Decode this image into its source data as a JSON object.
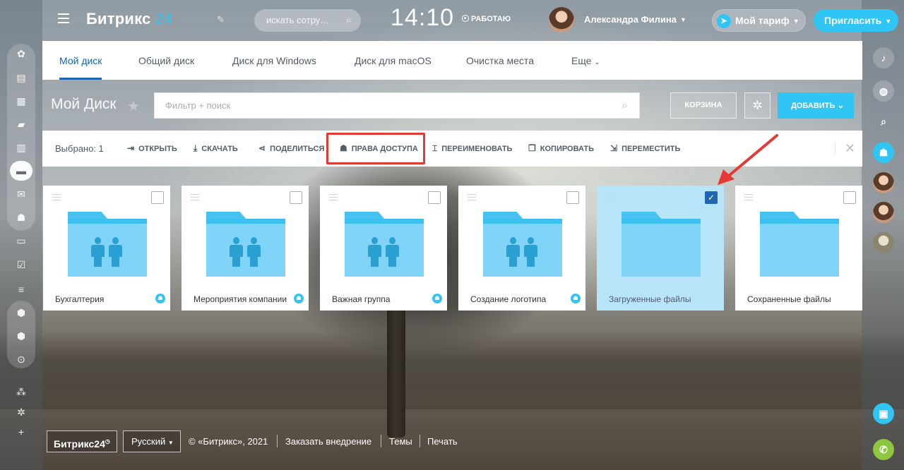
{
  "header": {
    "logo_text": "Битрикс",
    "logo_num": "24",
    "search_placeholder": "искать сотру…",
    "time": "14:10",
    "status": "РАБОТАЮ",
    "user_name": "Александра Филина",
    "tariff_label": "Мой тариф",
    "invite_label": "Пригласить"
  },
  "tabs": [
    {
      "label": "Мой диск"
    },
    {
      "label": "Общий диск"
    },
    {
      "label": "Диск для Windows"
    },
    {
      "label": "Диск для macOS"
    },
    {
      "label": "Очистка места"
    },
    {
      "label": "Еще"
    }
  ],
  "toolbar": {
    "title": "Мой Диск",
    "filter_placeholder": "Фильтр + поиск",
    "trash_label": "КОРЗИНА",
    "add_label": "ДОБАВИТЬ"
  },
  "actions": {
    "selected": "Выбрано: 1",
    "items": [
      {
        "label": "ОТКРЫТЬ",
        "icon": "open-icon"
      },
      {
        "label": "СКАЧАТЬ",
        "icon": "download-icon"
      },
      {
        "label": "ПОДЕЛИТЬСЯ",
        "icon": "share-icon"
      },
      {
        "label": "ПРАВА ДОСТУПА",
        "icon": "access-rights-icon"
      },
      {
        "label": "ПЕРЕИМЕНОВАТЬ",
        "icon": "rename-icon"
      },
      {
        "label": "КОПИРОВАТЬ",
        "icon": "copy-icon"
      },
      {
        "label": "ПЕРЕМЕСТИТЬ",
        "icon": "move-icon"
      }
    ]
  },
  "folders": [
    {
      "name": "Бухгалтерия",
      "shared": true,
      "selected": false
    },
    {
      "name": "Мероприятия компании",
      "shared": true,
      "selected": false
    },
    {
      "name": "Важная группа",
      "shared": true,
      "selected": false
    },
    {
      "name": "Создание логотипа",
      "shared": true,
      "selected": false
    },
    {
      "name": "Загруженные файлы",
      "shared": false,
      "selected": true
    },
    {
      "name": "Сохраненные файлы",
      "shared": false,
      "selected": false
    }
  ],
  "footer": {
    "logo": "Битрикс24",
    "language": "Русский",
    "copyright": "© «Битрикс», 2021",
    "order": "Заказать внедрение",
    "themes": "Темы",
    "print": "Печать"
  },
  "colors": {
    "accent": "#2fc6f6",
    "link": "#2066b0",
    "highlight": "#e53935"
  }
}
